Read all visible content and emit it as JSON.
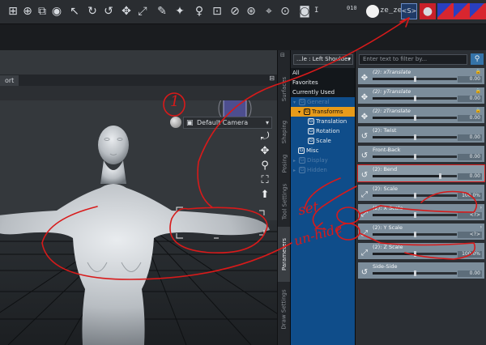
{
  "toolbar": {
    "icons": [
      {
        "name": "create-figure-icon",
        "glyph": "⊞"
      },
      {
        "name": "add-object-icon",
        "glyph": "⊕"
      },
      {
        "name": "new-scene-icon",
        "glyph": "⧉"
      },
      {
        "name": "primitive-icon",
        "glyph": "◉"
      },
      {
        "name": "pointer-tool-icon",
        "glyph": "↖"
      },
      {
        "name": "rotate-tool-icon",
        "glyph": "↻"
      },
      {
        "name": "orbit-tool-icon",
        "glyph": "↺"
      },
      {
        "name": "move-tool-icon",
        "glyph": "✥"
      },
      {
        "name": "scale-tool-icon",
        "glyph": "⤢"
      },
      {
        "name": "node-weight-brush-icon",
        "glyph": "✎"
      },
      {
        "name": "joint-editor-icon",
        "glyph": "✦"
      },
      {
        "name": "figure-pose-tool-icon",
        "glyph": "♀"
      },
      {
        "name": "geometry-editor-icon",
        "glyph": "⊡"
      },
      {
        "name": "surface-selection-icon",
        "glyph": "⊘"
      },
      {
        "name": "camera-orbit-icon",
        "glyph": "⊛"
      },
      {
        "name": "spot-render-icon",
        "glyph": "⌖"
      },
      {
        "name": "universal-tool-icon",
        "glyph": "⊙"
      },
      {
        "name": "render-camera-icon",
        "glyph": "◙"
      }
    ],
    "render_mode": "I",
    "grid_label": "010",
    "user_text": "ze_ze",
    "selected_tool": "<S>"
  },
  "viewport": {
    "tab_label": "ort",
    "camera_label": "Default Camera"
  },
  "dock_tabs": [
    "Surfaces",
    "Shaping",
    "Posing",
    "Tool Settings",
    "Parameters",
    "Draw Settings"
  ],
  "tree": {
    "node_select": "...le : Left Shoulder",
    "items": [
      {
        "label": "All",
        "style": "dark",
        "indent": 0,
        "arrow": "",
        "icon": false
      },
      {
        "label": "Favorites",
        "style": "dark",
        "indent": 0,
        "arrow": "",
        "icon": false
      },
      {
        "label": "Currently Used",
        "style": "dark",
        "indent": 0,
        "arrow": "",
        "icon": false
      },
      {
        "label": "General",
        "style": "dim",
        "indent": 1,
        "arrow": "▾",
        "icon": true
      },
      {
        "label": "Transforms",
        "style": "sel",
        "indent": 7,
        "arrow": "▾",
        "icon": true
      },
      {
        "label": "Translation",
        "style": "normal",
        "indent": 19,
        "arrow": "",
        "icon": true
      },
      {
        "label": "Rotation",
        "style": "normal",
        "indent": 19,
        "arrow": "",
        "icon": true
      },
      {
        "label": "Scale",
        "style": "normal",
        "indent": 19,
        "arrow": "",
        "icon": true
      },
      {
        "label": "Misc",
        "style": "normal",
        "indent": 7,
        "arrow": "",
        "icon": true
      },
      {
        "label": "Display",
        "style": "dim",
        "indent": 1,
        "arrow": "▸",
        "icon": true
      },
      {
        "label": "Hidden",
        "style": "dim",
        "indent": 1,
        "arrow": "▸",
        "icon": true
      }
    ]
  },
  "params": {
    "filter_placeholder": "Enter text to filter by...",
    "rows": [
      {
        "name": "(2): xTranslate",
        "italic": true,
        "icon": "✥",
        "value": "0.00",
        "slider": 0.5,
        "lock": true
      },
      {
        "name": "(2): yTranslate",
        "italic": true,
        "icon": "✥",
        "value": "0.00",
        "slider": 0.5,
        "lock": true
      },
      {
        "name": "(2): zTranslate",
        "italic": true,
        "icon": "✥",
        "value": "0.00",
        "slider": 0.5,
        "lock": true
      },
      {
        "name": "(2): Twist",
        "italic": false,
        "icon": "↺",
        "value": "0.00",
        "slider": 0.5,
        "lock": false
      },
      {
        "name": "Front-Back",
        "italic": false,
        "icon": "↺",
        "value": "0.00",
        "slider": 0.5,
        "lock": false
      },
      {
        "name": "(2): Bend",
        "italic": false,
        "icon": "↺",
        "value": "0.00",
        "slider": 0.8,
        "lock": false,
        "bend": true
      },
      {
        "name": "(2): Scale",
        "italic": false,
        "icon": "⤢",
        "value": "100.0%",
        "slider": 0.5,
        "lock": false
      },
      {
        "name": "(2): X Scale",
        "italic": false,
        "icon": "⤢",
        "value": "<?>",
        "slider": 0.5,
        "lock": false,
        "caret": true
      },
      {
        "name": "(2): Y Scale",
        "italic": false,
        "icon": "⤢",
        "value": "<?>",
        "slider": 0.5,
        "lock": false,
        "caret": true
      },
      {
        "name": "(2): Z Scale",
        "italic": false,
        "icon": "⤢",
        "value": "100.0%",
        "slider": 0.5,
        "lock": false
      },
      {
        "name": "Side-Side",
        "italic": false,
        "icon": "↺",
        "value": "0.00",
        "slider": 0.5,
        "lock": false
      }
    ]
  },
  "annotations": {
    "number": "1",
    "note_line1": "set",
    "note_line2": "un-hide",
    "color": "#d81a1a"
  }
}
